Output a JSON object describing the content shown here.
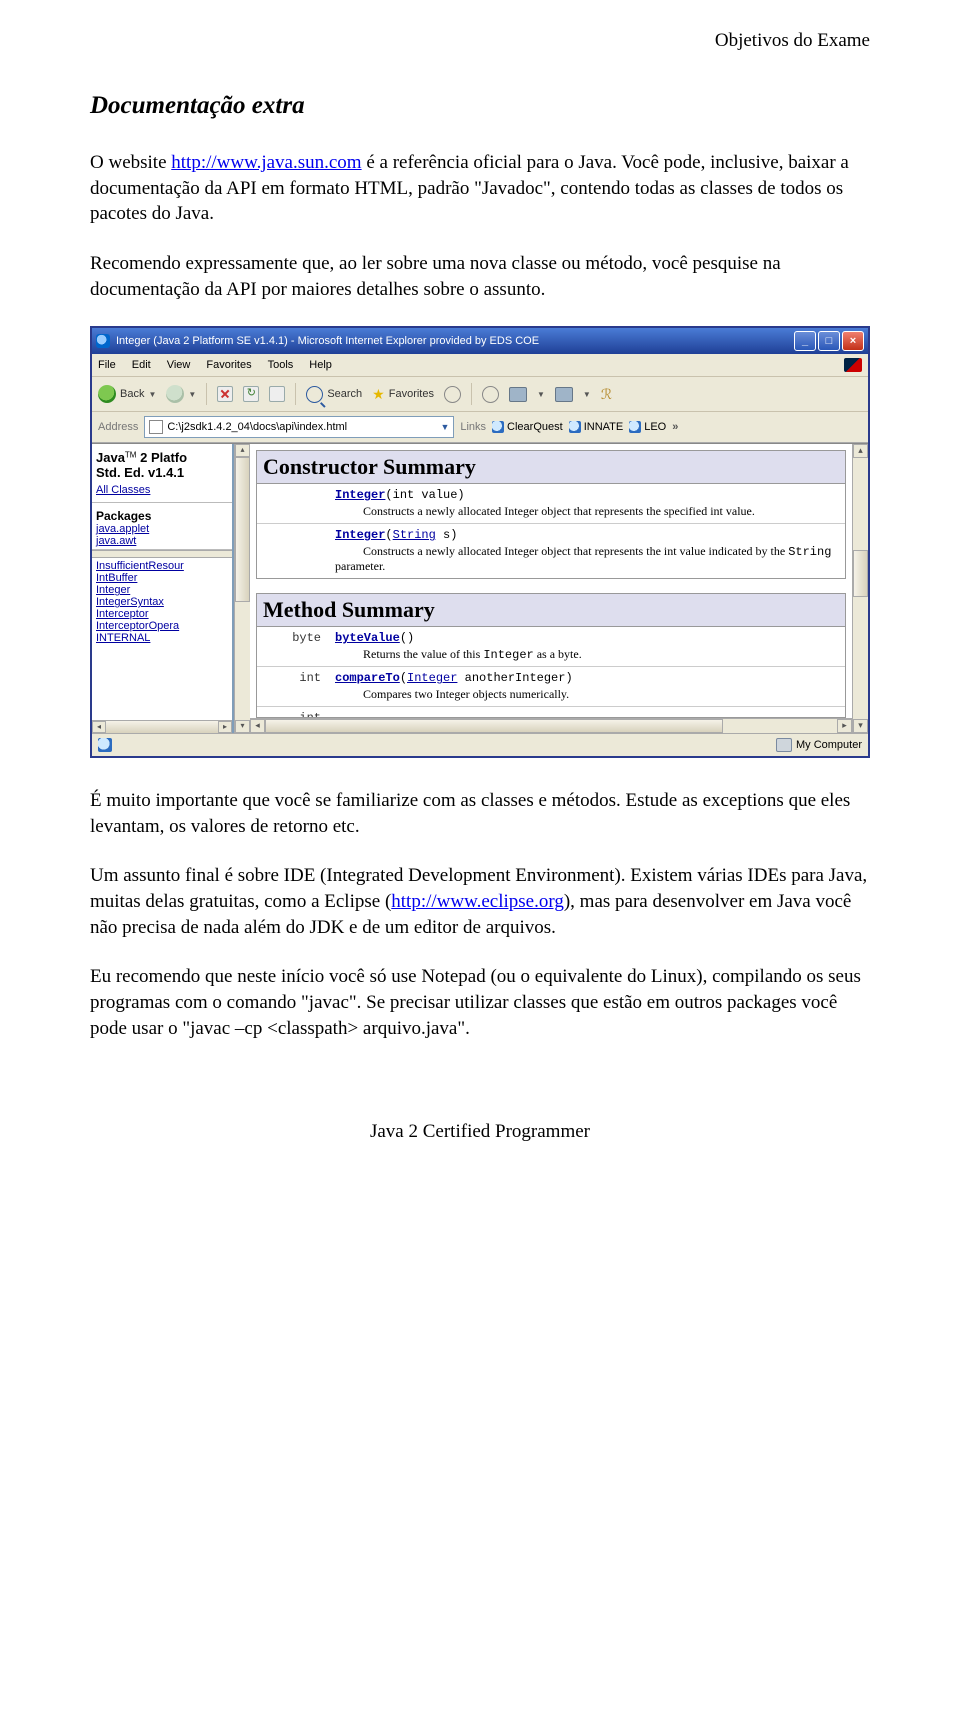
{
  "header": {
    "right": "Objetivos do Exame"
  },
  "title": "Documentação extra",
  "para1a": "O website ",
  "para1link": "http://www.java.sun.com",
  "para1b": " é a referência oficial para o Java. Você pode, inclusive, baixar a documentação da API em formato HTML, padrão \"Javadoc\", contendo todas as classes de todos os pacotes do Java.",
  "para2": "Recomendo expressamente que, ao ler sobre uma nova classe ou método, você pesquise na documentação da API por maiores detalhes sobre o assunto.",
  "para3": "É muito importante que você se familiarize com as classes e métodos. Estude as exceptions que eles levantam, os valores de retorno etc.",
  "para4a": "Um assunto final é sobre IDE (Integrated Development Environment). Existem várias IDEs para Java, muitas delas gratuitas, como a Eclipse (",
  "para4link": "http://www.eclipse.org",
  "para4b": "), mas para desenvolver em Java você não precisa de nada além do JDK e de um editor de arquivos.",
  "para5": "Eu recomendo que neste início você só use Notepad (ou o equivalente do Linux), compilando os seus programas com o comando \"javac\". Se precisar utilizar classes que estão em outros packages você pode usar o \"javac –cp <classpath> arquivo.java\".",
  "footer": "Java 2 Certified Programmer",
  "ie": {
    "title": "Integer (Java 2 Platform SE v1.4.1) - Microsoft Internet Explorer provided by EDS COE",
    "menus": [
      "File",
      "Edit",
      "View",
      "Favorites",
      "Tools",
      "Help"
    ],
    "toolbar": {
      "back": "Back",
      "search": "Search",
      "favorites": "Favorites"
    },
    "addr": {
      "label": "Address",
      "value": "C:\\j2sdk1.4.2_04\\docs\\api\\index.html",
      "links": "Links",
      "q": [
        "ClearQuest",
        "INNATE",
        "LEO"
      ]
    },
    "side": {
      "platform": "Java™ 2 Platfo",
      "ed": "Std. Ed. v1.4.1",
      "all": "All Classes",
      "pkgh": "Packages",
      "pkgs": [
        "java.applet",
        "java.awt"
      ],
      "classes": [
        "InsufficientResour",
        "IntBuffer",
        "Integer",
        "IntegerSyntax",
        "Interceptor",
        "InterceptorOpera",
        "INTERNAL"
      ]
    },
    "constructor": {
      "title": "Constructor Summary",
      "rows": [
        {
          "sig_m": "Integer",
          "sig_args": "(int value)",
          "desc": "Constructs a newly allocated Integer object that represents the specified int value."
        },
        {
          "sig_m": "Integer",
          "sig_args1": "(",
          "sig_link": "String",
          "sig_args2": " s)",
          "desc_a": "Constructs a newly allocated Integer object that represents the int value indicated by the ",
          "desc_code": "String",
          "desc_b": " parameter."
        }
      ]
    },
    "method": {
      "title": "Method Summary",
      "rows": [
        {
          "ret": "byte",
          "m": "byteValue",
          "args": "()",
          "desc_a": "Returns the value of this ",
          "desc_code": "Integer",
          "desc_b": " as a byte."
        },
        {
          "ret": "int",
          "m": "compareTo",
          "args1": "(",
          "arg_link": "Integer",
          "args2": " anotherInteger)",
          "desc": "Compares two Integer objects numerically."
        },
        {
          "ret": "int"
        }
      ]
    },
    "status": "My Computer"
  }
}
